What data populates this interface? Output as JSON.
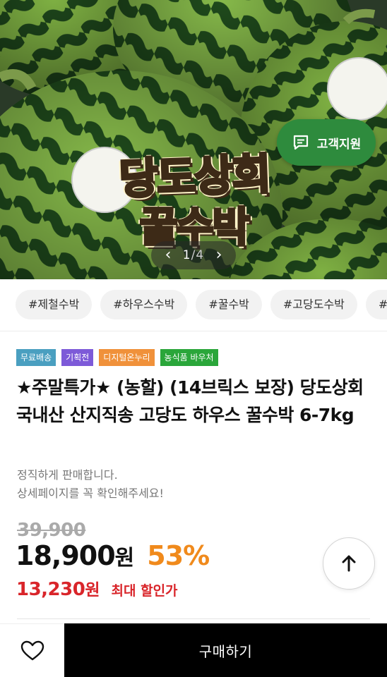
{
  "hero": {
    "title_line1": "당도상회",
    "title_line2": "꿀수박",
    "support_button_label": "고객지원",
    "pager": {
      "current": "1",
      "separator": "/",
      "total": "4"
    }
  },
  "hashtags": [
    "#제철수박",
    "#하우스수박",
    "#꿀수박",
    "#고당도수박",
    "#수박"
  ],
  "badges": [
    {
      "label": "무료배송",
      "color": "#4a9fc0"
    },
    {
      "label": "기획전",
      "color": "#7d5ad8"
    },
    {
      "label": "디지털온누리",
      "color": "#f0913a"
    },
    {
      "label": "농식품 바우처",
      "color": "#2aa63a"
    }
  ],
  "product": {
    "title": "★주말특가★ (농할) (14브릭스 보장) 당도상회 국내산 산지직송 고당도 하우스 꿀수박 6-7kg",
    "desc_line1": "정직하게 판매합니다.",
    "desc_line2": "상세페이지를 꼭 확인해주세요!"
  },
  "price": {
    "original": "39,900",
    "sale": "18,900",
    "unit": "원",
    "discount": "53%",
    "max_discount_price": "13,230",
    "max_discount_label": "최대 할인가"
  },
  "bottom": {
    "buy_label": "구매하기"
  },
  "colors": {
    "support_button": "#2e8b3d",
    "discount": "#f08a1c",
    "max_price": "#d9252a",
    "buy_button": "#000000"
  },
  "icons": {
    "support": "chat-bubble-icon",
    "scroll_top": "arrow-up-icon",
    "wishlist": "heart-icon"
  }
}
